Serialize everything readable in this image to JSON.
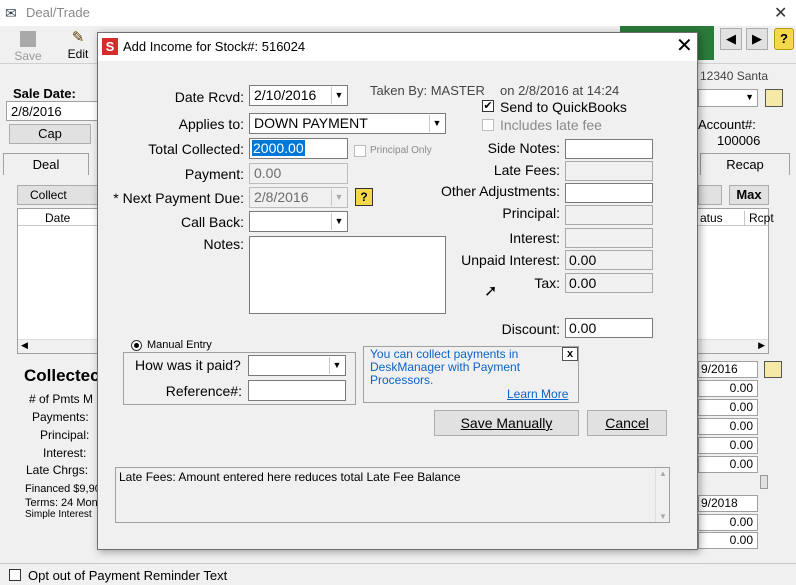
{
  "bg": {
    "window_title": "Deal/Trade",
    "toolbar": {
      "save_label": "Save",
      "edit_label": "Edit"
    },
    "sale_date_label": "Sale Date:",
    "sale_date_value": "2/8/2016",
    "cap_button": "Cap",
    "address_partial": "12340 Santa",
    "account_label": "Account#:",
    "account_value": "100006",
    "tab_deal": "Deal",
    "tab_recap": "Recap",
    "collect_btn": "Collect Payme",
    "max_btn": "Max",
    "col_date": "Date",
    "col_status": "atus",
    "col_rcpt": "Rcpt",
    "collected_heading": "Collectec",
    "pmts_label": "# of Pmts M",
    "payments_label": "Payments:",
    "principal_label": "Principal:",
    "interest_label": "Interest:",
    "late_chrgs_label": "Late Chrgs:",
    "financed_label": "Financed $9,90",
    "terms_label": "Terms: 24 Mon",
    "simple_interest_label": "Simple Interest",
    "right_date1": "9/2016",
    "right_values": [
      "0.00",
      "0.00",
      "0.00",
      "0.00",
      "0.00"
    ],
    "right_date2": "9/2018",
    "right_values2": [
      "0.00",
      "0.00"
    ],
    "opt_out_label": "Opt out of Payment Reminder Text"
  },
  "dialog": {
    "title": "Add Income for Stock#: 516024",
    "taken_by": "Taken By: MASTER",
    "taken_on": "on 2/8/2016 at 14:24",
    "date_rcvd_label": "Date Rcvd:",
    "date_rcvd_value": "2/10/2016",
    "applies_to_label": "Applies to:",
    "applies_to_value": "DOWN PAYMENT",
    "total_collected_label": "Total Collected:",
    "total_collected_value": "2000.00",
    "principal_only_label": "Principal Only",
    "payment_label": "Payment:",
    "payment_value": "0.00",
    "next_payment_label": "* Next Payment Due:",
    "next_payment_value": "2/8/2016",
    "call_back_label": "Call Back:",
    "call_back_value": "",
    "notes_label": "Notes:",
    "notes_value": "",
    "send_qb_label": "Send to QuickBooks",
    "includes_late_fee_label": "Includes late fee",
    "side_notes_label": "Side Notes:",
    "side_notes_value": "",
    "late_fees_label": "Late Fees:",
    "late_fees_value": "",
    "other_adj_label": "Other Adjustments:",
    "other_adj_value": "",
    "principal_label": "Principal:",
    "principal_value": "",
    "interest_label": "Interest:",
    "interest_value": "",
    "unpaid_interest_label": "Unpaid Interest:",
    "unpaid_interest_value": "0.00",
    "tax_label": "Tax:",
    "tax_value": "0.00",
    "discount_label": "Discount:",
    "discount_value": "0.00",
    "manual_entry_label": "Manual Entry",
    "how_paid_label": "How was it paid?",
    "how_paid_value": "",
    "reference_label": "Reference#:",
    "reference_value": "",
    "info_text": "You can collect payments in DeskManager with Payment Processors.",
    "learn_more": "Learn More",
    "info_close": "x",
    "save_manually": "Save Manually",
    "cancel": "Cancel",
    "help_text": "Late Fees: Amount entered here reduces total Late Fee Balance"
  },
  "colors": {
    "accent_blue": "#0a64c8",
    "selection": "#0078d7",
    "brand_red": "#d72c2c",
    "link": "#0a64c8"
  }
}
